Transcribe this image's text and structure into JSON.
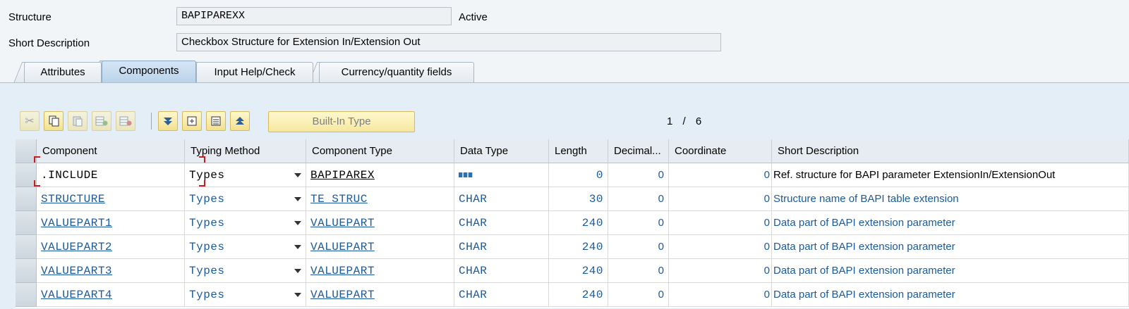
{
  "header": {
    "structure_label": "Structure",
    "structure_value": "BAPIPAREXX",
    "status": "Active",
    "short_desc_label": "Short Description",
    "short_desc_value": "Checkbox Structure for Extension In/Extension Out"
  },
  "tabs": [
    {
      "label": "Attributes",
      "active": false
    },
    {
      "label": "Components",
      "active": true
    },
    {
      "label": "Input Help/Check",
      "active": false
    },
    {
      "label": "Currency/quantity fields",
      "active": false
    }
  ],
  "toolbar": {
    "builtin_label": "Built-In Type",
    "pager_current": "1",
    "pager_sep": "/",
    "pager_total": "6",
    "icons": [
      "cut-icon",
      "copy-icon",
      "paste-icon",
      "insert-row-icon",
      "delete-row-icon",
      "move-down-icon",
      "expand-icon",
      "details-icon",
      "move-up-icon"
    ]
  },
  "table": {
    "columns": [
      "Component",
      "Typing Method",
      "Component Type",
      "Data Type",
      "Length",
      "Decimal...",
      "Coordinate",
      "Short Description"
    ],
    "rows": [
      {
        "component": ".INCLUDE",
        "typing": "Types",
        "ctype": "BAPIPAREX",
        "dtype": "",
        "length": "0",
        "decimals": "0",
        "coordinate": "0",
        "desc": "Ref. structure for BAPI parameter ExtensionIn/ExtensionOut"
      },
      {
        "component": "STRUCTURE",
        "typing": "Types",
        "ctype": "TE_STRUC",
        "dtype": "CHAR",
        "length": "30",
        "decimals": "0",
        "coordinate": "0",
        "desc": "Structure name of  BAPI table extension"
      },
      {
        "component": "VALUEPART1",
        "typing": "Types",
        "ctype": "VALUEPART",
        "dtype": "CHAR",
        "length": "240",
        "decimals": "0",
        "coordinate": "0",
        "desc": "Data part of BAPI extension parameter"
      },
      {
        "component": "VALUEPART2",
        "typing": "Types",
        "ctype": "VALUEPART",
        "dtype": "CHAR",
        "length": "240",
        "decimals": "0",
        "coordinate": "0",
        "desc": "Data part of BAPI extension parameter"
      },
      {
        "component": "VALUEPART3",
        "typing": "Types",
        "ctype": "VALUEPART",
        "dtype": "CHAR",
        "length": "240",
        "decimals": "0",
        "coordinate": "0",
        "desc": "Data part of BAPI extension parameter"
      },
      {
        "component": "VALUEPART4",
        "typing": "Types",
        "ctype": "VALUEPART",
        "dtype": "CHAR",
        "length": "240",
        "decimals": "0",
        "coordinate": "0",
        "desc": "Data part of BAPI extension parameter"
      }
    ]
  },
  "colors": {
    "link": "#1a5a9c",
    "panel": "#e4eef6",
    "button": "#f3e08e"
  }
}
